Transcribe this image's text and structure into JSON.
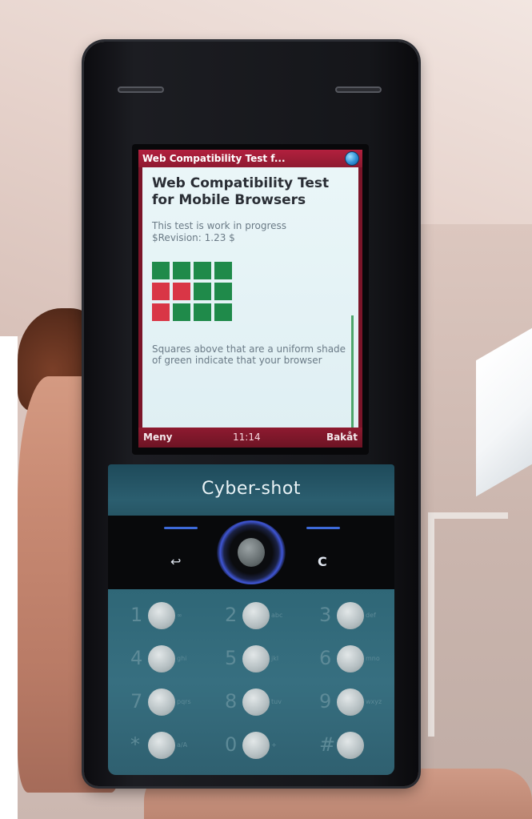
{
  "browser": {
    "title_bar": "Web Compatibility Test f...",
    "page_heading": "Web Compatibility Test for Mobile Browsers",
    "page_note_line1": "This test is work in progress",
    "page_note_line2": "$Revision: 1.23 $",
    "trailing_text": "Squares above that are a uniform shade of green indicate that your browser",
    "test_squares": [
      [
        "green",
        "green",
        "green",
        "green"
      ],
      [
        "red",
        "red",
        "green",
        "green"
      ],
      [
        "red",
        "green",
        "green",
        "green"
      ]
    ]
  },
  "softkeys": {
    "left": "Meny",
    "center": "11:14",
    "right": "Bakåt"
  },
  "device": {
    "brand": "Cyber-shot",
    "back_symbol": "↩",
    "clear_label": "C",
    "keys": [
      {
        "num": "1",
        "sub": "∞"
      },
      {
        "num": "2",
        "sub": "abc"
      },
      {
        "num": "3",
        "sub": "def"
      },
      {
        "num": "4",
        "sub": "ghi"
      },
      {
        "num": "5",
        "sub": "jkl"
      },
      {
        "num": "6",
        "sub": "mno"
      },
      {
        "num": "7",
        "sub": "pqrs"
      },
      {
        "num": "8",
        "sub": "tuv"
      },
      {
        "num": "9",
        "sub": "wxyz"
      },
      {
        "num": "*",
        "sub": "a/A"
      },
      {
        "num": "0",
        "sub": "+"
      },
      {
        "num": "#",
        "sub": ""
      }
    ]
  }
}
